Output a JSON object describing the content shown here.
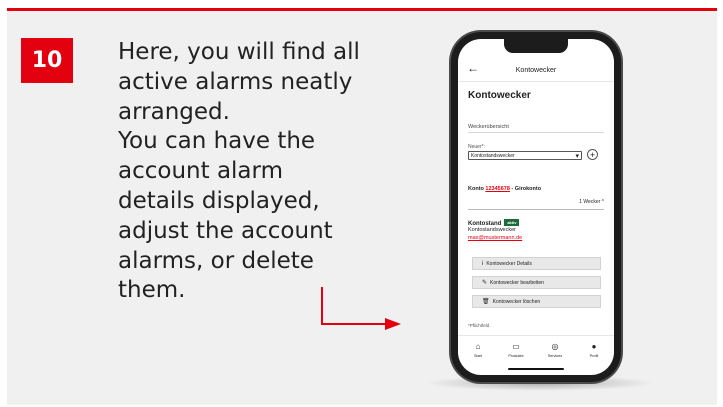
{
  "instruction": {
    "step": "10",
    "lines": [
      "Here, you will find all",
      "active alarms neatly",
      "arranged.",
      "You can have the",
      "account alarm",
      "details displayed,",
      "adjust the account",
      "alarms, or delete",
      "them."
    ]
  },
  "colors": {
    "accent": "#e3000f",
    "badge": "#1e6b3a",
    "background": "#f0f0f0"
  },
  "phone": {
    "back_icon": "←",
    "top_title": "Kontowecker",
    "heading": "Kontowecker",
    "section_label": "Weckerübersicht",
    "new_label": "Neuer*:",
    "select_value": "Kontostandswecker",
    "select_chevron": "▾",
    "add_icon": "+",
    "account_number": "12345678",
    "account_suffix": " - Girokonto",
    "alarm_count": "1 Wecker ^",
    "alarm": {
      "title": "Kontostand",
      "badge": "aktiv",
      "type": "Kontostandswecker",
      "email": "max@mustermann.de"
    },
    "buttons": [
      {
        "icon": "i",
        "label": "Kontowecker Details"
      },
      {
        "icon": "✎",
        "label": "Kontowecker bearbeiten"
      },
      {
        "icon": "🗑",
        "label": "Kontowecker löschen"
      }
    ],
    "required_note": "*Pflichtfeld",
    "nav": [
      {
        "icon": "⌂",
        "label": "Start"
      },
      {
        "icon": "▭",
        "label": "Produkte"
      },
      {
        "icon": "◎",
        "label": "Services"
      },
      {
        "icon": "●",
        "label": "Profil"
      }
    ]
  }
}
